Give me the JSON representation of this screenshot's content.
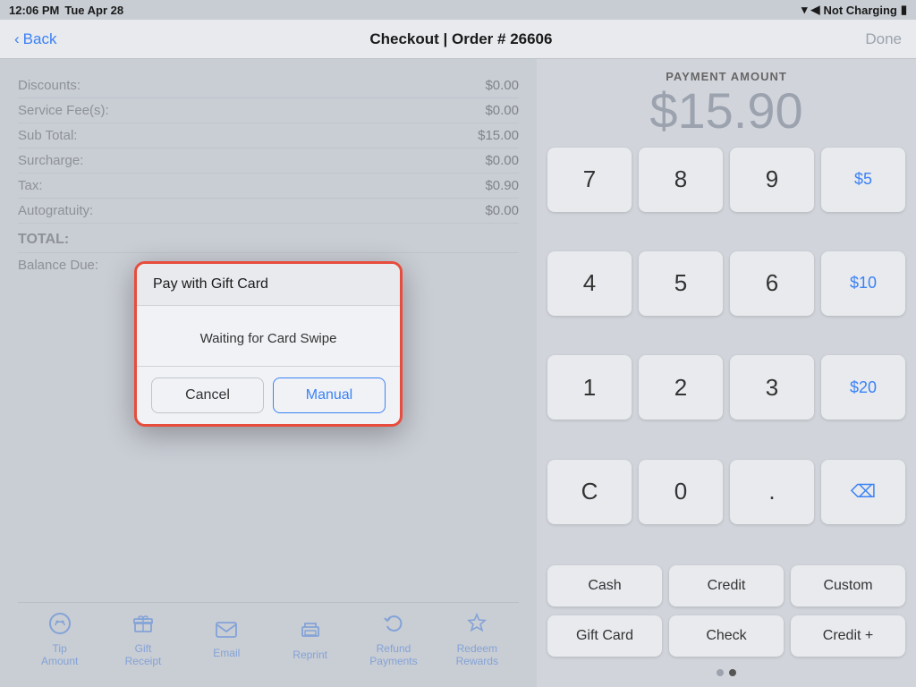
{
  "statusBar": {
    "time": "12:06 PM",
    "date": "Tue Apr 28",
    "batteryStatus": "Not Charging"
  },
  "navBar": {
    "backLabel": "Back",
    "title": "Checkout | Order # 26606",
    "doneLabel": "Done"
  },
  "orderSummary": {
    "rows": [
      {
        "label": "Discounts:",
        "value": "$0.00"
      },
      {
        "label": "Service Fee(s):",
        "value": "$0.00"
      },
      {
        "label": "Sub Total:",
        "value": "$15.00"
      },
      {
        "label": "Surcharge:",
        "value": "$0.00"
      },
      {
        "label": "Tax:",
        "value": "$0.90"
      },
      {
        "label": "Autogratuity:",
        "value": "$0.00"
      },
      {
        "label": "TOTAL:",
        "value": ""
      },
      {
        "label": "Balance Due:",
        "value": ""
      }
    ]
  },
  "toolbar": {
    "items": [
      {
        "icon": "⊙",
        "label": "Tip\nAmount"
      },
      {
        "icon": "🎁",
        "label": "Gift\nReceipt"
      },
      {
        "icon": "✉",
        "label": "Email"
      },
      {
        "icon": "⎙",
        "label": "Reprint"
      },
      {
        "icon": "↩",
        "label": "Refund\nPayments"
      },
      {
        "icon": "🏆",
        "label": "Redeem\nRewards"
      }
    ]
  },
  "payment": {
    "amountLabel": "PAYMENT AMOUNT",
    "amount": "$15.90"
  },
  "numpad": {
    "keys": [
      {
        "label": "7",
        "type": "digit"
      },
      {
        "label": "8",
        "type": "digit"
      },
      {
        "label": "9",
        "type": "digit"
      },
      {
        "label": "$5",
        "type": "preset"
      },
      {
        "label": "4",
        "type": "digit"
      },
      {
        "label": "5",
        "type": "digit"
      },
      {
        "label": "6",
        "type": "digit"
      },
      {
        "label": "$10",
        "type": "preset"
      },
      {
        "label": "1",
        "type": "digit"
      },
      {
        "label": "2",
        "type": "digit"
      },
      {
        "label": "3",
        "type": "digit"
      },
      {
        "label": "$20",
        "type": "preset"
      },
      {
        "label": "C",
        "type": "digit"
      },
      {
        "label": "0",
        "type": "digit"
      },
      {
        "label": ".",
        "type": "digit"
      },
      {
        "label": "⌫",
        "type": "backspace"
      }
    ]
  },
  "paymentTypes": {
    "row1": [
      {
        "label": "Cash"
      },
      {
        "label": "Credit"
      },
      {
        "label": "Custom"
      }
    ],
    "row2": [
      {
        "label": "Gift Card"
      },
      {
        "label": "Check"
      },
      {
        "label": "Credit +"
      }
    ]
  },
  "dialog": {
    "title": "Pay with Gift Card",
    "message": "Waiting for Card Swipe",
    "cancelLabel": "Cancel",
    "manualLabel": "Manual"
  },
  "pagination": {
    "dots": [
      false,
      true,
      false
    ]
  }
}
